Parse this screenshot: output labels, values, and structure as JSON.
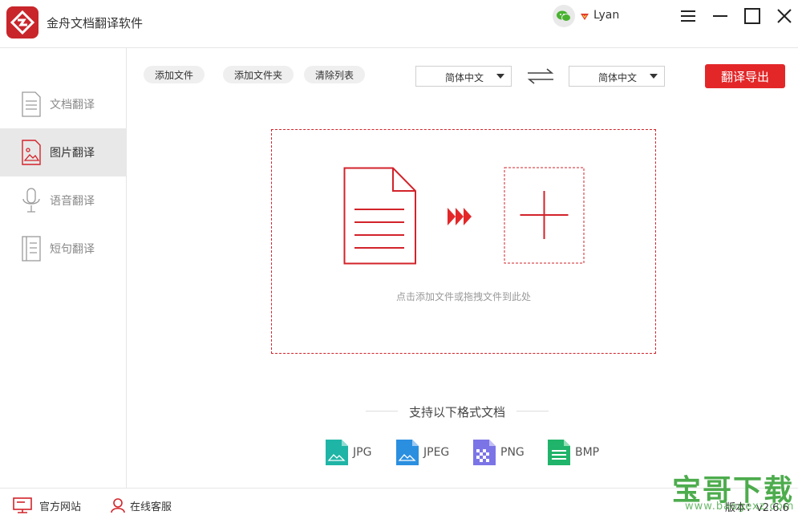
{
  "app": {
    "title": "金舟文档翻译软件",
    "username": "Lyan",
    "brand_color": "#c8262b",
    "accent_color": "#e32729"
  },
  "window_controls": [
    "menu-icon",
    "minimize-icon",
    "maximize-icon",
    "close-icon"
  ],
  "sidebar": {
    "items": [
      {
        "label": "文档翻译",
        "icon": "document-icon",
        "active": false
      },
      {
        "label": "图片翻译",
        "icon": "image-icon",
        "active": true
      },
      {
        "label": "语音翻译",
        "icon": "microphone-icon",
        "active": false
      },
      {
        "label": "短句翻译",
        "icon": "text-lines-icon",
        "active": false
      }
    ]
  },
  "toolbar": {
    "add_file": "添加文件",
    "add_folder": "添加文件夹",
    "clear_list": "清除列表",
    "source_lang": "简体中文",
    "target_lang": "简体中文",
    "export": "翻译导出"
  },
  "drop_zone": {
    "hint": "点击添加文件或拖拽文件到此处"
  },
  "formats": {
    "title": "支持以下格式文档",
    "items": [
      {
        "label": "JPG",
        "color": "#1fb5a6"
      },
      {
        "label": "JPEG",
        "color": "#2b8fe0"
      },
      {
        "label": "PNG",
        "color": "#7b74e6"
      },
      {
        "label": "BMP",
        "color": "#20b36a"
      }
    ]
  },
  "footer": {
    "website": "官方网站",
    "support": "在线客服",
    "version": "版本：v2.6.6"
  },
  "watermark": {
    "text": "宝哥下载",
    "url": "www.baogexz.com"
  }
}
